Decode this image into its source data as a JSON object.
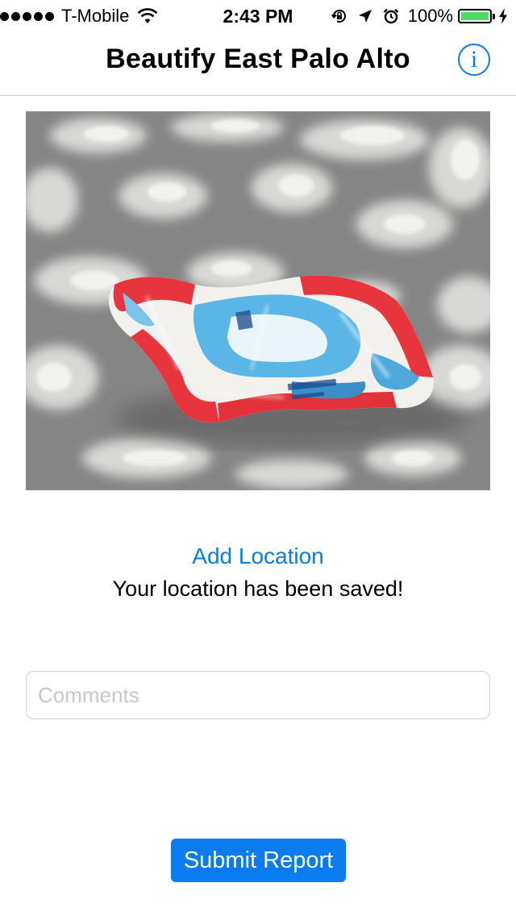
{
  "status_bar": {
    "carrier": "T-Mobile",
    "time": "2:43 PM",
    "battery_percent": "100%",
    "signal_bars": 5,
    "battery_level": 1.0,
    "battery_color": "#4cd964",
    "icons": [
      "signal-dots-icon",
      "wifi-icon",
      "rotation-lock-icon",
      "location-arrow-icon",
      "alarm-icon",
      "battery-icon",
      "charging-bolt-icon"
    ]
  },
  "nav": {
    "title": "Beautify East Palo Alto",
    "info_icon": "info-icon",
    "info_glyph": "i"
  },
  "photo": {
    "subject": "photo of litter: crumpled plastic bag on asphalt"
  },
  "location": {
    "add_label": "Add Location",
    "status_text": "Your location has been saved!"
  },
  "comments": {
    "placeholder": "Comments",
    "value": ""
  },
  "submit": {
    "label": "Submit Report"
  },
  "colors": {
    "accent": "#0a7cf0",
    "divider": "#c8c7cc",
    "placeholder": "#c7c7cd"
  }
}
